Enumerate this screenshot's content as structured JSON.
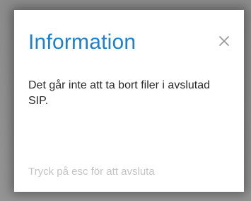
{
  "dialog": {
    "title": "Information",
    "close_icon": "close-icon",
    "message": "Det går inte att ta bort filer i avslutad SIP.",
    "hint": "Tryck på esc för att avsluta"
  },
  "colors": {
    "title": "#1f7fc8",
    "backdrop": "#8f8f8f",
    "hint": "#c4c4c4"
  }
}
